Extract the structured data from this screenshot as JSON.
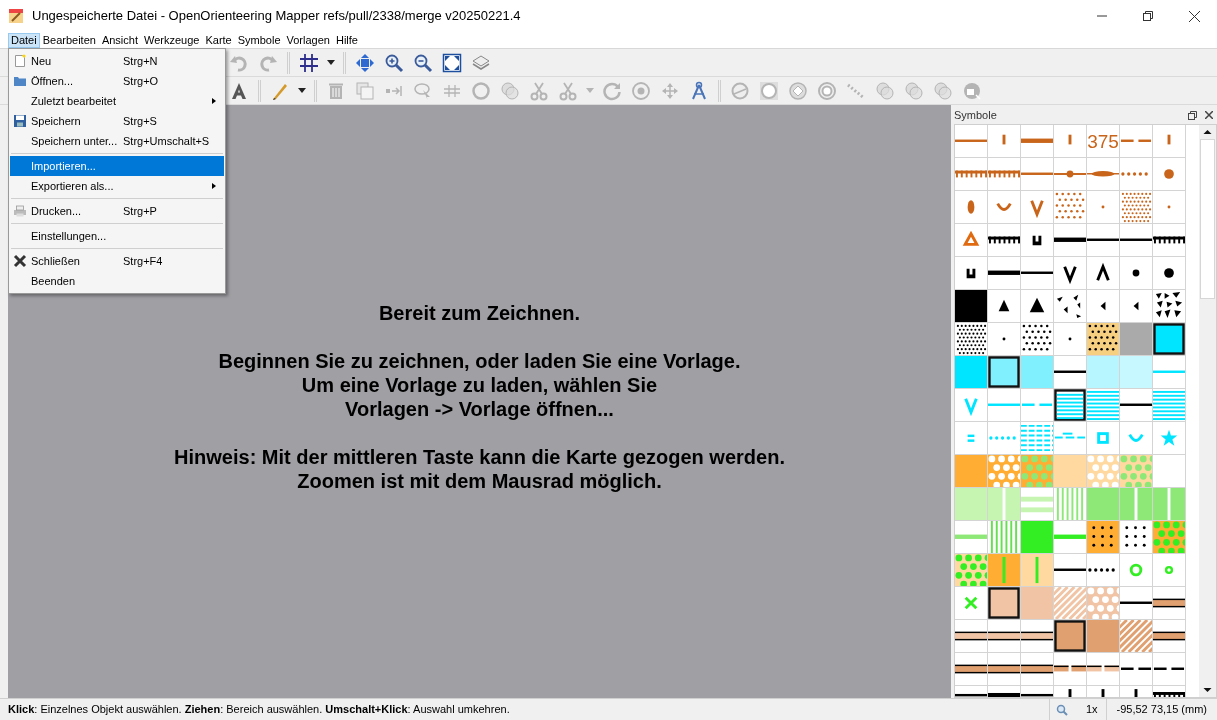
{
  "window": {
    "title": "Ungespeicherte Datei - OpenOrienteering Mapper refs/pull/2338/merge v20250221.4"
  },
  "menubar": [
    {
      "label": "Datei",
      "selected": true
    },
    {
      "label": "Bearbeiten",
      "selected": false
    },
    {
      "label": "Ansicht",
      "selected": false
    },
    {
      "label": "Werkzeuge",
      "selected": false
    },
    {
      "label": "Karte",
      "selected": false
    },
    {
      "label": "Symbole",
      "selected": false
    },
    {
      "label": "Vorlagen",
      "selected": false
    },
    {
      "label": "Hilfe",
      "selected": false
    }
  ],
  "menu": [
    {
      "kind": "item",
      "label": "Neu",
      "shortcut": "Strg+N",
      "submenu": false,
      "selected": false
    },
    {
      "kind": "item",
      "label": "Öffnen...",
      "shortcut": "Strg+O",
      "submenu": false,
      "selected": false
    },
    {
      "kind": "item",
      "label": "Zuletzt bearbeitet",
      "submenu": true,
      "selected": false
    },
    {
      "kind": "item",
      "label": "Speichern",
      "shortcut": "Strg+S",
      "submenu": false,
      "selected": false
    },
    {
      "kind": "item",
      "label": "Speichern unter...",
      "shortcut": "Strg+Umschalt+S",
      "submenu": false,
      "selected": false
    },
    {
      "kind": "separator"
    },
    {
      "kind": "item",
      "label": "Importieren...",
      "submenu": false,
      "selected": true
    },
    {
      "kind": "item",
      "label": "Exportieren als...",
      "submenu": true,
      "selected": false
    },
    {
      "kind": "separator"
    },
    {
      "kind": "item",
      "label": "Drucken...",
      "shortcut": "Strg+P",
      "submenu": false,
      "selected": false
    },
    {
      "kind": "separator"
    },
    {
      "kind": "item",
      "label": "Einstellungen...",
      "submenu": false,
      "selected": false
    },
    {
      "kind": "separator"
    },
    {
      "kind": "item",
      "label": "Schließen",
      "shortcut": "Strg+F4",
      "submenu": false,
      "selected": false
    },
    {
      "kind": "item",
      "label": "Beenden",
      "submenu": false,
      "selected": false
    }
  ],
  "toolbars": [
    {
      "items": [
        {
          "kind": "undo",
          "disabled": true
        },
        {
          "kind": "redo",
          "disabled": true
        },
        {
          "kind": "separator"
        },
        {
          "kind": "grid",
          "disabled": false
        },
        {
          "kind": "caret",
          "disabled": false
        },
        {
          "kind": "separator"
        },
        {
          "kind": "pan",
          "disabled": false
        },
        {
          "kind": "zoom_in",
          "disabled": false
        },
        {
          "kind": "zoom_out",
          "disabled": false
        },
        {
          "kind": "fit",
          "disabled": false
        },
        {
          "kind": "layers",
          "disabled": false
        }
      ]
    },
    {
      "items": [
        {
          "kind": "text_tool",
          "disabled": false
        },
        {
          "kind": "separator"
        },
        {
          "kind": "pencil",
          "disabled": false
        },
        {
          "kind": "caret",
          "disabled": false
        },
        {
          "kind": "separator"
        },
        {
          "kind": "trash",
          "disabled": true
        },
        {
          "kind": "duplicate",
          "disabled": true
        },
        {
          "kind": "switch_dir",
          "disabled": true
        },
        {
          "kind": "lasso",
          "disabled": true
        },
        {
          "kind": "hash",
          "disabled": true
        },
        {
          "kind": "ring",
          "disabled": true
        },
        {
          "kind": "circles",
          "disabled": true
        },
        {
          "kind": "scissors",
          "disabled": true
        },
        {
          "kind": "scissors",
          "disabled": true
        },
        {
          "kind": "caret",
          "disabled": true
        },
        {
          "kind": "rotate",
          "disabled": true
        },
        {
          "kind": "scale",
          "disabled": true
        },
        {
          "kind": "move",
          "disabled": true
        },
        {
          "kind": "compass",
          "disabled": false
        },
        {
          "kind": "separator"
        },
        {
          "kind": "circle_slash",
          "disabled": true
        },
        {
          "kind": "circle_square",
          "disabled": true
        },
        {
          "kind": "ring_diamond",
          "disabled": true
        },
        {
          "kind": "ring_double",
          "disabled": true
        },
        {
          "kind": "dots_diag",
          "disabled": true
        },
        {
          "kind": "circles",
          "disabled": true
        },
        {
          "kind": "circles",
          "disabled": true
        },
        {
          "kind": "circles",
          "disabled": true
        },
        {
          "kind": "globe",
          "disabled": true
        }
      ]
    }
  ],
  "canvas": {
    "paragraphs": [
      [
        "Bereit zum Zeichnen."
      ],
      [
        "Beginnen Sie zu zeichnen, oder laden Sie eine Vorlage.",
        "Um eine Vorlage zu laden, wählen Sie",
        "Vorlagen -> Vorlage öffnen..."
      ],
      [
        "Hinweis: Mit der mittleren Taste kann die Karte gezogen werden.",
        "Zoomen ist mit dem Mausrad möglich."
      ]
    ]
  },
  "symbols": {
    "title": "Symbole",
    "symbol_label": "375"
  },
  "status_bar": {
    "hint": "**Klick**: Einzelnes Objekt auswählen. **Ziehen**: Bereich auswählen. **Umschalt+Klick**: Auswahl umkehren.",
    "zoom": "1x",
    "coordinates": "-95,52 73,15 (mm)"
  }
}
